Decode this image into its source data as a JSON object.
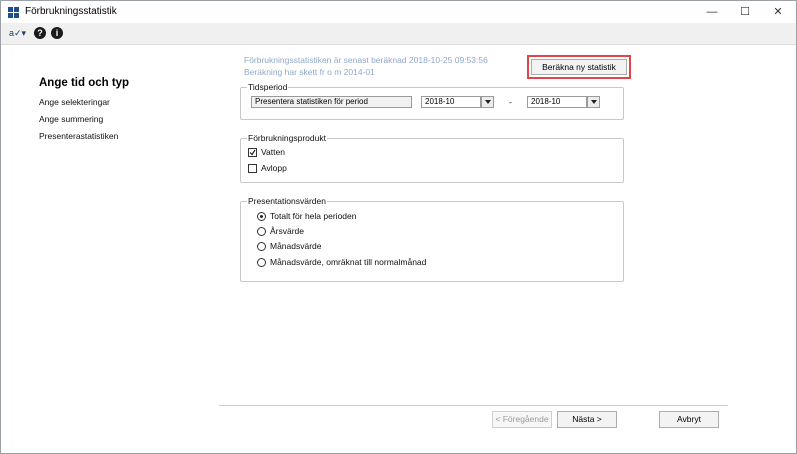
{
  "window": {
    "title": "Förbrukningsstatistik",
    "controls": {
      "minimize": "—",
      "maximize": "☐",
      "close": "✕"
    }
  },
  "toolbar": {
    "icons": [
      "spelling-tool-icon",
      "help-icon",
      "info-icon"
    ],
    "help_glyph": "?",
    "info_glyph": "i",
    "tool_glyph": "a✓▾"
  },
  "sidebar": {
    "title": "Ange tid och typ",
    "items": [
      {
        "label": "Ange selekteringar"
      },
      {
        "label": "Ange summering"
      },
      {
        "label": "Presenterastatistiken"
      }
    ]
  },
  "info": {
    "line1": "Förbrukningsstatistiken är senast beräknad 2018-10-25 09:53:56",
    "line2": "Beräkning har skett fr o m 2014-01"
  },
  "calculate_button": "Beräkna ny statistik",
  "tidsperiod": {
    "legend": "Tidsperiod",
    "mode_value": "Presentera statistiken för period",
    "from_value": "2018-10",
    "separator": "-",
    "to_value": "2018-10"
  },
  "produkt": {
    "legend": "Förbrukningsprodukt",
    "options": [
      {
        "label": "Vatten",
        "checked": true
      },
      {
        "label": "Avlopp",
        "checked": false
      }
    ]
  },
  "presentation": {
    "legend": "Presentationsvärden",
    "options": [
      {
        "label": "Totalt för hela perioden",
        "selected": true
      },
      {
        "label": "Årsvärde",
        "selected": false
      },
      {
        "label": "Månadsvärde",
        "selected": false
      },
      {
        "label": "Månadsvärde, omräknat till normalmånad",
        "selected": false
      }
    ]
  },
  "footer": {
    "prev": "< Föregående",
    "next": "Nästa >",
    "cancel": "Avbryt"
  },
  "colors": {
    "accent_highlight": "#e0454a",
    "info_text": "#8fa9c9",
    "app_icon": "#1f4e8c"
  }
}
